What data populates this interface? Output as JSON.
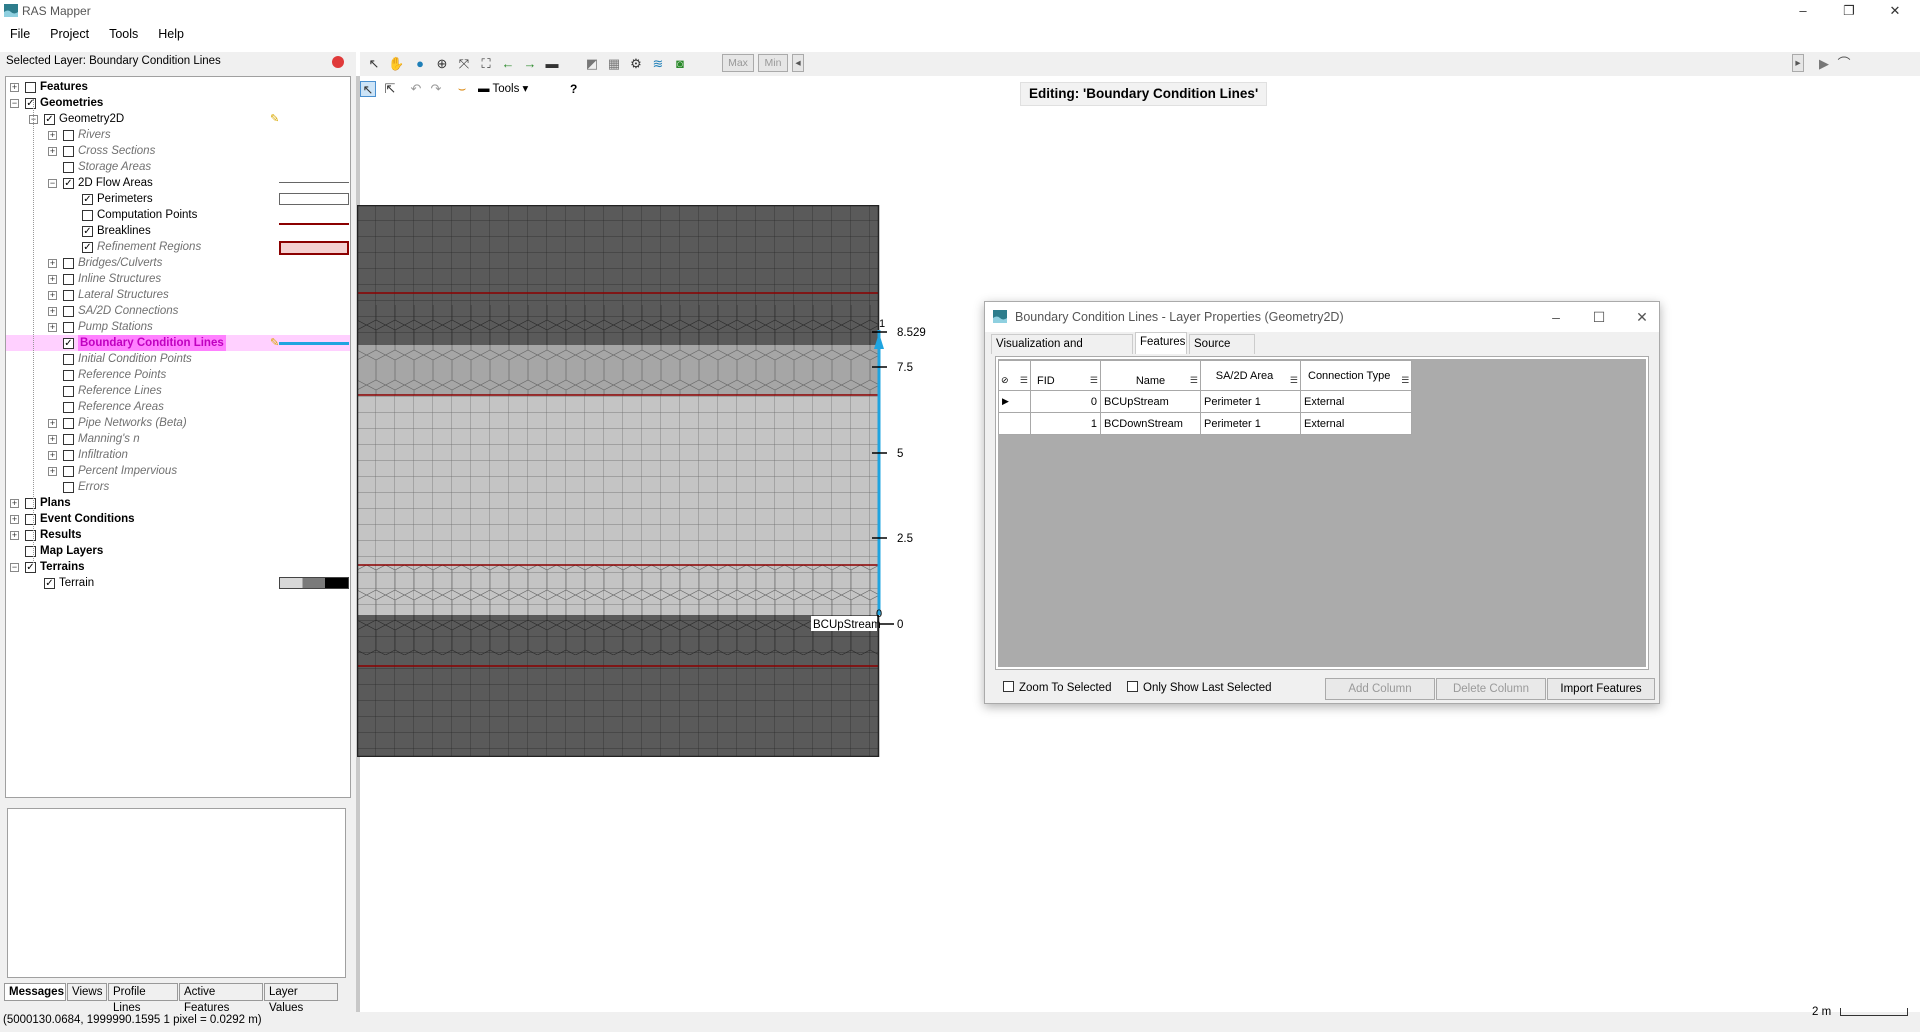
{
  "window": {
    "title": "RAS Mapper",
    "minimize": "–",
    "maximize": "❐",
    "close": "✕"
  },
  "menu": [
    "File",
    "Project",
    "Tools",
    "Help"
  ],
  "selected_layer_text": "Selected Layer: Boundary Condition Lines",
  "tree": [
    {
      "label": "Features",
      "level": 0,
      "exp": "+",
      "checked": false,
      "style": "bold"
    },
    {
      "label": "Geometries",
      "level": 0,
      "exp": "-",
      "checked": true,
      "style": "bold"
    },
    {
      "label": "Geometry2D",
      "level": 1,
      "exp": "-",
      "checked": true,
      "style": "normal",
      "pencil": true
    },
    {
      "label": "Rivers",
      "level": 2,
      "exp": "+",
      "checked": false,
      "style": "ital"
    },
    {
      "label": "Cross Sections",
      "level": 2,
      "exp": "+",
      "checked": false,
      "style": "ital"
    },
    {
      "label": "Storage Areas",
      "level": 2,
      "exp": "",
      "checked": false,
      "style": "ital"
    },
    {
      "label": "2D Flow Areas",
      "level": 2,
      "exp": "-",
      "checked": true,
      "style": "normal"
    },
    {
      "label": "Perimeters",
      "level": 3,
      "exp": "",
      "checked": true,
      "style": "normal"
    },
    {
      "label": "Computation Points",
      "level": 3,
      "exp": "",
      "checked": false,
      "style": "normal"
    },
    {
      "label": "Breaklines",
      "level": 3,
      "exp": "",
      "checked": true,
      "style": "normal"
    },
    {
      "label": "Refinement Regions",
      "level": 3,
      "exp": "",
      "checked": true,
      "style": "ital"
    },
    {
      "label": "Bridges/Culverts",
      "level": 2,
      "exp": "+",
      "checked": false,
      "style": "ital"
    },
    {
      "label": "Inline Structures",
      "level": 2,
      "exp": "+",
      "checked": false,
      "style": "ital"
    },
    {
      "label": "Lateral Structures",
      "level": 2,
      "exp": "+",
      "checked": false,
      "style": "ital"
    },
    {
      "label": "SA/2D Connections",
      "level": 2,
      "exp": "+",
      "checked": false,
      "style": "ital"
    },
    {
      "label": "Pump Stations",
      "level": 2,
      "exp": "+",
      "checked": false,
      "style": "ital"
    },
    {
      "label": "Boundary Condition Lines",
      "level": 2,
      "exp": "",
      "checked": true,
      "style": "selected",
      "pencil": true
    },
    {
      "label": "Initial Condition Points",
      "level": 2,
      "exp": "",
      "checked": false,
      "style": "ital"
    },
    {
      "label": "Reference Points",
      "level": 2,
      "exp": "",
      "checked": false,
      "style": "ital"
    },
    {
      "label": "Reference Lines",
      "level": 2,
      "exp": "",
      "checked": false,
      "style": "ital"
    },
    {
      "label": "Reference Areas",
      "level": 2,
      "exp": "",
      "checked": false,
      "style": "ital"
    },
    {
      "label": "Pipe Networks (Beta)",
      "level": 2,
      "exp": "+",
      "checked": false,
      "style": "ital"
    },
    {
      "label": "Manning's n",
      "level": 2,
      "exp": "+",
      "checked": false,
      "style": "ital"
    },
    {
      "label": "Infiltration",
      "level": 2,
      "exp": "+",
      "checked": false,
      "style": "ital"
    },
    {
      "label": "Percent Impervious",
      "level": 2,
      "exp": "+",
      "checked": false,
      "style": "ital"
    },
    {
      "label": "Errors",
      "level": 2,
      "exp": "",
      "checked": false,
      "style": "ital"
    },
    {
      "label": "Plans",
      "level": 0,
      "exp": "+",
      "checked": false,
      "style": "bold"
    },
    {
      "label": "Event Conditions",
      "level": 0,
      "exp": "+",
      "checked": false,
      "style": "bold"
    },
    {
      "label": "Results",
      "level": 0,
      "exp": "+",
      "checked": false,
      "style": "bold"
    },
    {
      "label": "Map Layers",
      "level": 0,
      "exp": "",
      "checked": false,
      "style": "bold"
    },
    {
      "label": "Terrains",
      "level": 0,
      "exp": "-",
      "checked": true,
      "style": "bold"
    },
    {
      "label": "Terrain",
      "level": 1,
      "exp": "",
      "checked": true,
      "style": "normal"
    }
  ],
  "bottom_tabs": [
    "Messages",
    "Views",
    "Profile Lines",
    "Active Features",
    "Layer Values"
  ],
  "status": {
    "coords": "(5000130.0684, 1999990.1595  1 pixel = 0.0292 m)",
    "scale": "2 m"
  },
  "toolbar": {
    "max": "Max",
    "min": "Min",
    "tools": "Tools",
    "help": "?"
  },
  "editing_label": "Editing: 'Boundary Condition Lines'",
  "profile_labels": {
    "top_index": "1",
    "top_value": "8.529",
    "t75": "7.5",
    "t5": "5",
    "t25": "2.5",
    "bottom_index": "0",
    "bc_name": "BCUpStream",
    "bottom_value": "0"
  },
  "dialog": {
    "title": "Boundary Condition Lines - Layer Properties (Geometry2D)",
    "tabs": [
      "Visualization and Information",
      "Features",
      "Source Files"
    ],
    "active_tab": "Features",
    "columns": [
      "FID",
      "Name",
      "SA/2D Area",
      "Connection Type"
    ],
    "rows": [
      {
        "fid": "0",
        "name": "BCUpStream",
        "area": "Perimeter 1",
        "type": "External"
      },
      {
        "fid": "1",
        "name": "BCDownStream",
        "area": "Perimeter 1",
        "type": "External"
      }
    ],
    "zoom_to_selected": "Zoom To Selected",
    "only_show_last": "Only Show Last Selected",
    "add_column": "Add Column",
    "delete_column": "Delete Column",
    "import_features": "Import Features"
  },
  "colors": {
    "selected_bg": "#ff80ff",
    "selected_text": "#c000c0",
    "breakline": "#8b0000",
    "bc_line": "#1fa4e0"
  }
}
